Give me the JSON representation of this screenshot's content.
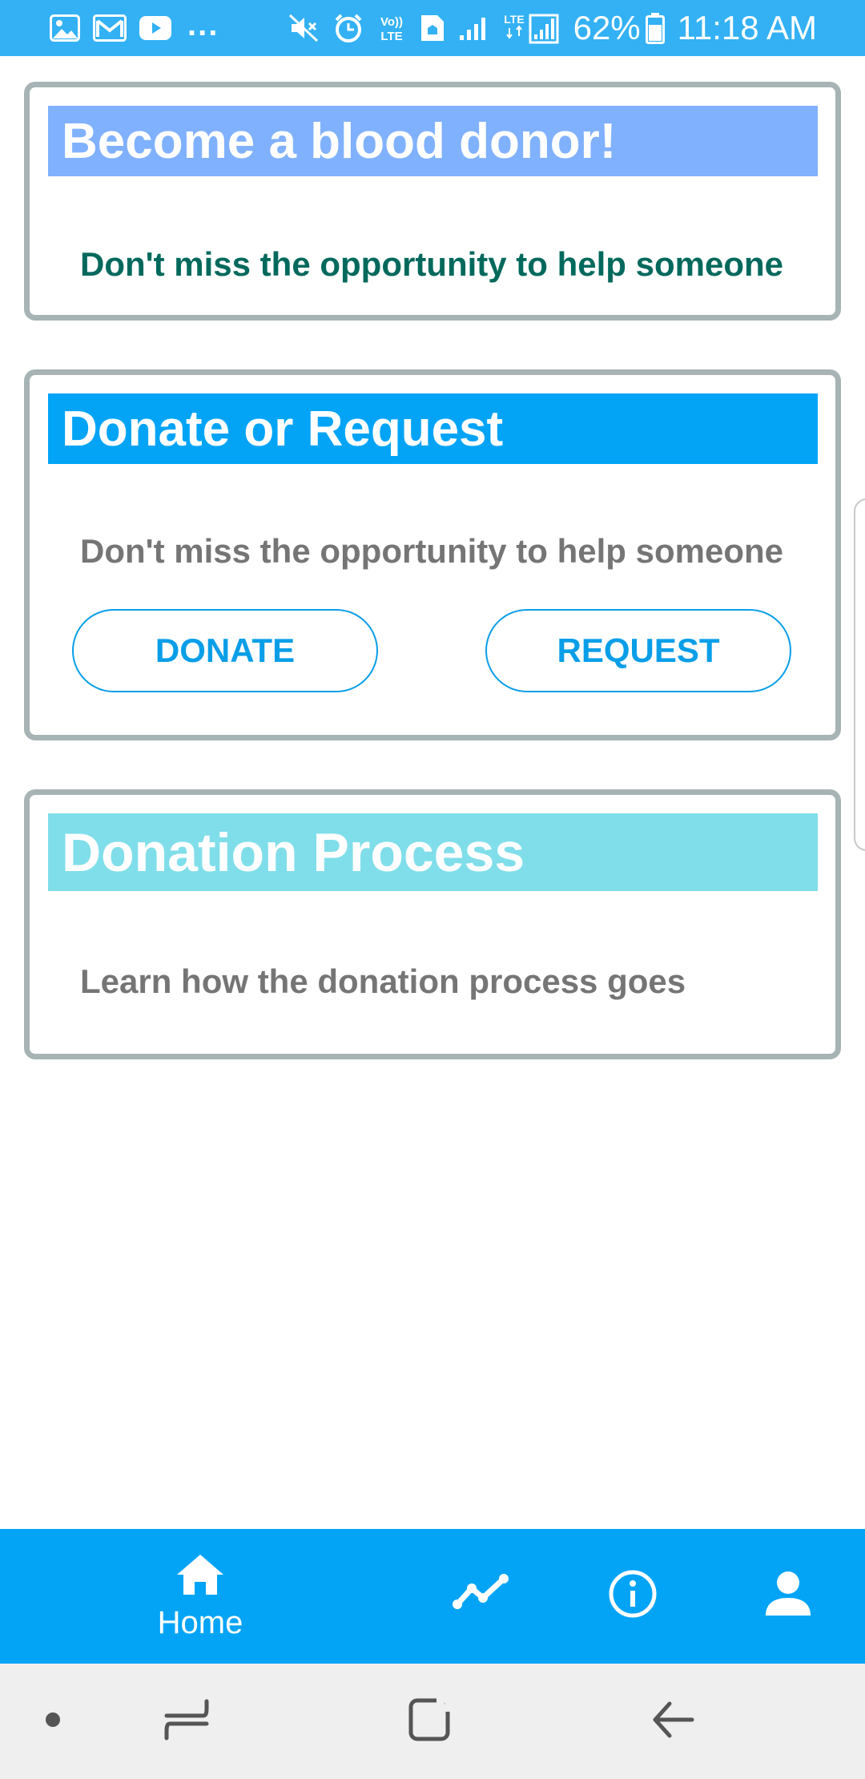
{
  "status_bar": {
    "left_icons": [
      "gallery-icon",
      "gmail-icon",
      "youtube-icon"
    ],
    "more_indicator": "...",
    "right_icons": [
      "mute-icon",
      "alarm-icon",
      "volte-icon",
      "file-icon",
      "signal-icon",
      "lte-signal-icon",
      "battery-icon"
    ],
    "volte_label": "Vo)) LTE",
    "lte_label": "LTE",
    "battery": "62%",
    "time": "11:18 AM",
    "background_color": "#33b1f4"
  },
  "cards": {
    "become_donor": {
      "title": "Become a blood donor!",
      "subtitle": "Don't miss the opportunity to help someone",
      "header_color": "#80b1fe",
      "subtitle_color": "#00695c"
    },
    "donate_request": {
      "title": "Donate or Request",
      "subtitle": "Don't miss the opportunity to help someone",
      "donate_label": "DONATE",
      "request_label": "REQUEST",
      "header_color": "#03a4f6",
      "subtitle_color": "#757575"
    },
    "donation_process": {
      "title": "Donation Process",
      "subtitle": "Learn how the donation process goes",
      "header_color": "#80deea",
      "subtitle_color": "#757575"
    }
  },
  "bottom_nav": {
    "background_color": "#03a4f6",
    "items": [
      {
        "icon": "home-icon",
        "label": "Home",
        "active": true
      },
      {
        "icon": "trending-icon",
        "label": ""
      },
      {
        "icon": "info-icon",
        "label": ""
      },
      {
        "icon": "person-icon",
        "label": ""
      }
    ]
  },
  "system_nav": {
    "buttons": [
      "dot-icon",
      "recents-icon",
      "home-square-icon",
      "back-icon"
    ]
  }
}
